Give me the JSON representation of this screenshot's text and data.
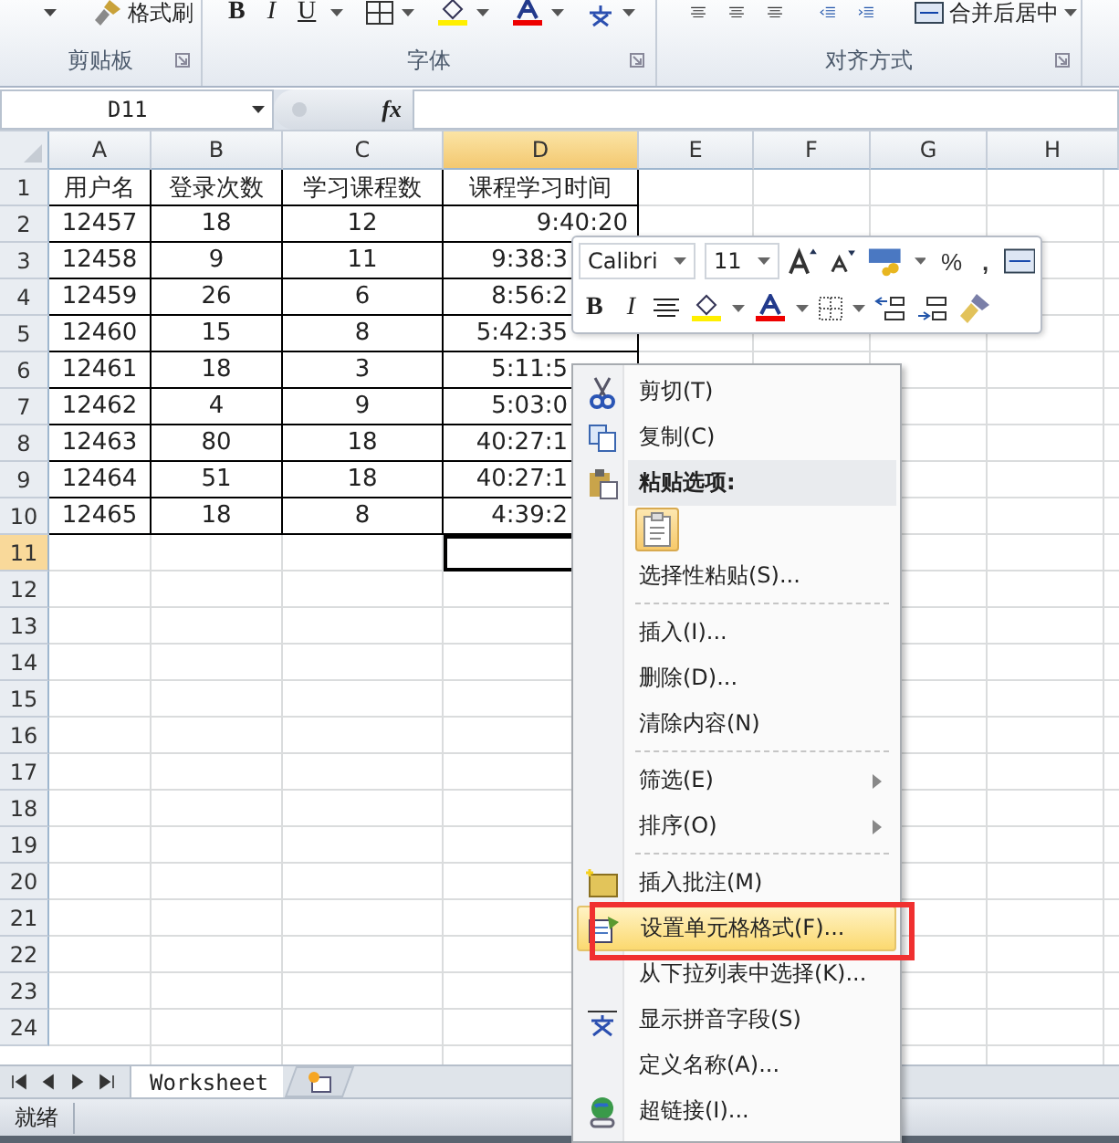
{
  "ribbon": {
    "groups": [
      {
        "label": "剪贴板",
        "kind": "clipboard"
      },
      {
        "label": "字体",
        "kind": "font"
      },
      {
        "label": "对齐方式",
        "kind": "align"
      }
    ],
    "format_painter": "格式刷",
    "bold": "B",
    "italic": "I",
    "underline": "U",
    "merge_center": "合并后居中"
  },
  "formula_bar": {
    "name_box": "D11",
    "fx": "fx"
  },
  "sheet": {
    "columns": [
      {
        "label": "A",
        "selected": false
      },
      {
        "label": "B",
        "selected": false
      },
      {
        "label": "C",
        "selected": false
      },
      {
        "label": "D",
        "selected": true
      },
      {
        "label": "E",
        "selected": false
      },
      {
        "label": "F",
        "selected": false
      },
      {
        "label": "G",
        "selected": false
      },
      {
        "label": "H",
        "selected": false
      }
    ],
    "rows": [
      {
        "label": "1",
        "selected": false,
        "cells": [
          "用户名",
          "登录次数",
          "学习课程数",
          "课程学习时间"
        ]
      },
      {
        "label": "2",
        "selected": false,
        "cells": [
          "12457",
          "18",
          "12",
          "9:40:20"
        ]
      },
      {
        "label": "3",
        "selected": false,
        "cells": [
          "12458",
          "9",
          "11",
          "9:38:3"
        ]
      },
      {
        "label": "4",
        "selected": false,
        "cells": [
          "12459",
          "26",
          "6",
          "8:56:2"
        ]
      },
      {
        "label": "5",
        "selected": false,
        "cells": [
          "12460",
          "15",
          "8",
          "5:42:35"
        ]
      },
      {
        "label": "6",
        "selected": false,
        "cells": [
          "12461",
          "18",
          "3",
          "5:11:5"
        ]
      },
      {
        "label": "7",
        "selected": false,
        "cells": [
          "12462",
          "4",
          "9",
          "5:03:0"
        ]
      },
      {
        "label": "8",
        "selected": false,
        "cells": [
          "12463",
          "80",
          "18",
          "40:27:1"
        ]
      },
      {
        "label": "9",
        "selected": false,
        "cells": [
          "12464",
          "51",
          "18",
          "40:27:1"
        ]
      },
      {
        "label": "10",
        "selected": false,
        "cells": [
          "12465",
          "18",
          "8",
          "4:39:2"
        ]
      },
      {
        "label": "11",
        "selected": true,
        "cells": []
      },
      {
        "label": "12",
        "selected": false,
        "cells": []
      },
      {
        "label": "13",
        "selected": false,
        "cells": []
      },
      {
        "label": "14",
        "selected": false,
        "cells": []
      },
      {
        "label": "15",
        "selected": false,
        "cells": []
      },
      {
        "label": "16",
        "selected": false,
        "cells": []
      },
      {
        "label": "17",
        "selected": false,
        "cells": []
      },
      {
        "label": "18",
        "selected": false,
        "cells": []
      },
      {
        "label": "19",
        "selected": false,
        "cells": []
      },
      {
        "label": "20",
        "selected": false,
        "cells": []
      },
      {
        "label": "21",
        "selected": false,
        "cells": []
      },
      {
        "label": "22",
        "selected": false,
        "cells": []
      },
      {
        "label": "23",
        "selected": false,
        "cells": []
      },
      {
        "label": "24",
        "selected": false,
        "cells": []
      }
    ]
  },
  "mini_toolbar": {
    "font": "Calibri",
    "size": "11",
    "percent": "%",
    "comma": ",",
    "bold": "B",
    "italic": "I"
  },
  "context_menu": [
    {
      "kind": "item",
      "label": "剪切(T)",
      "selected": false,
      "submenu": false
    },
    {
      "kind": "item",
      "label": "复制(C)",
      "selected": false,
      "submenu": false
    },
    {
      "kind": "header",
      "label": "粘贴选项:"
    },
    {
      "kind": "paste"
    },
    {
      "kind": "item",
      "label": "选择性粘贴(S)...",
      "selected": false,
      "submenu": false
    },
    {
      "kind": "separator"
    },
    {
      "kind": "item",
      "label": "插入(I)...",
      "selected": false,
      "submenu": false
    },
    {
      "kind": "item",
      "label": "删除(D)...",
      "selected": false,
      "submenu": false
    },
    {
      "kind": "item",
      "label": "清除内容(N)",
      "selected": false,
      "submenu": false
    },
    {
      "kind": "separator"
    },
    {
      "kind": "item",
      "label": "筛选(E)",
      "selected": false,
      "submenu": true
    },
    {
      "kind": "item",
      "label": "排序(O)",
      "selected": false,
      "submenu": true
    },
    {
      "kind": "separator"
    },
    {
      "kind": "item",
      "label": "插入批注(M)",
      "selected": false,
      "submenu": false
    },
    {
      "kind": "item",
      "label": "设置单元格格式(F)...",
      "selected": true,
      "submenu": false,
      "outlined": true
    },
    {
      "kind": "item",
      "label": "从下拉列表中选择(K)...",
      "selected": false,
      "submenu": false
    },
    {
      "kind": "item",
      "label": "显示拼音字段(S)",
      "selected": false,
      "submenu": false
    },
    {
      "kind": "item",
      "label": "定义名称(A)...",
      "selected": false,
      "submenu": false
    },
    {
      "kind": "item",
      "label": "超链接(I)...",
      "selected": false,
      "submenu": false
    }
  ],
  "sheet_tabs": [
    {
      "label": "Worksheet",
      "selected": true
    }
  ],
  "status_bar": {
    "text": "就绪"
  }
}
